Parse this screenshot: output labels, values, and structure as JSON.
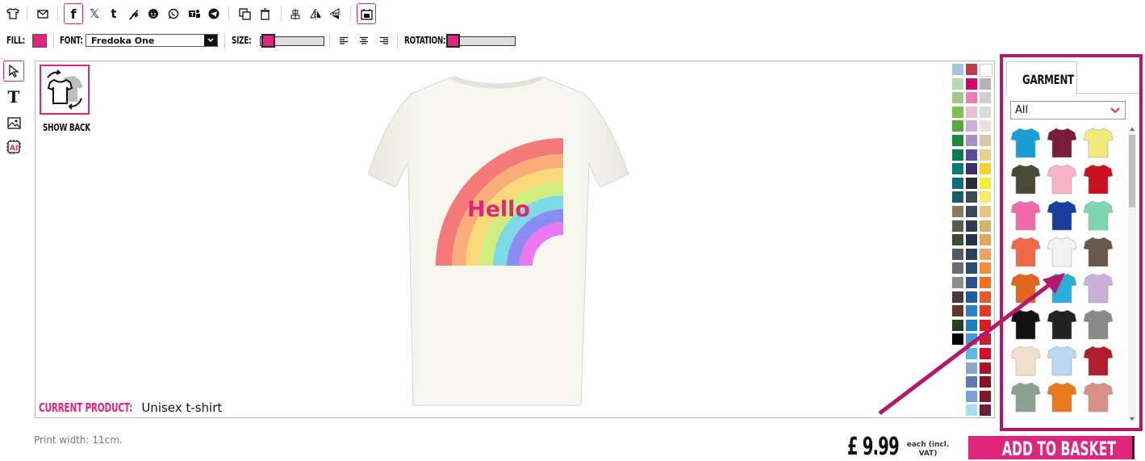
{
  "toolbar": {
    "fill_label": "FILL:",
    "fill_color": "#e0257c",
    "font_label": "FONT:",
    "font_value": "Fredoka One",
    "size_label": "SIZE:",
    "rotation_label": "ROTATION:",
    "accent_color": "#e0257c"
  },
  "side_tools": [
    "select-tool",
    "text-tool",
    "image-tool",
    "ai-tool"
  ],
  "show_back_label": "SHOW BACK",
  "design": {
    "text": "Hello",
    "text_color": "#e0257c"
  },
  "current_product": {
    "label": "CURRENT PRODUCT:",
    "value": "Unisex t-shirt"
  },
  "print_width": "Print width: 11cm.",
  "price": {
    "value": "£ 9.99",
    "note_line1": "each (incl.",
    "note_line2": "VAT)"
  },
  "add_to_basket": "ADD TO BASKET",
  "garment_panel": {
    "tab": "GARMENT",
    "filter_value": "All"
  },
  "palette": [
    [
      "#a8c4d8",
      "#c0394f",
      "#ffffff"
    ],
    [
      "#b7d9b5",
      "#d1006a",
      "#b3b3b3"
    ],
    [
      "#a6c48a",
      "#f07cb3",
      "#cfcfcf"
    ],
    [
      "#7cc24a",
      "#e7c0d1",
      "#dcdcdc"
    ],
    [
      "#5aa63a",
      "#cdb0d6",
      "#e8e2d4"
    ],
    [
      "#1b8a3c",
      "#a990c2",
      "#d9c9a8"
    ],
    [
      "#0e7a52",
      "#5c4b9c",
      "#e7d48b"
    ],
    [
      "#0c7a73",
      "#3d2e6e",
      "#f2d22e"
    ],
    [
      "#0e6b7a",
      "#2c2c38",
      "#f1ee3a"
    ],
    [
      "#1b5a6a",
      "#3a4b58",
      "#f5ea6a"
    ],
    [
      "#8a7a5c",
      "#39495b",
      "#e8c77a"
    ],
    [
      "#555e4a",
      "#2e3e52",
      "#d4b36a"
    ],
    [
      "#3e4b3a",
      "#24344a",
      "#e3a75a"
    ],
    [
      "#525a66",
      "#29405c",
      "#f1a462"
    ],
    [
      "#6a6e72",
      "#2d4873",
      "#f08c3a"
    ],
    [
      "#8a8e92",
      "#2a4f8c",
      "#f0701e"
    ],
    [
      "#4a3a3a",
      "#1f5ea3",
      "#e45a2a"
    ],
    [
      "#5a3a2a",
      "#2a82c6",
      "#e03a2a"
    ],
    [
      "#263d26",
      "#1c7ebf",
      "#d42020"
    ],
    [
      "#000000",
      "#3aa0d8",
      "#c81e2e"
    ],
    [
      "",
      "#5cb8e6",
      "#d80a2a"
    ],
    [
      "",
      "#8aa8c8",
      "#b0102a"
    ],
    [
      "",
      "#5a7eb4",
      "#8a0e26"
    ],
    [
      "",
      "#7aa0d4",
      "#7a1a2a"
    ],
    [
      "",
      "#a6e0f4",
      "#6a1e3a"
    ]
  ],
  "garments": [
    [
      "#1a9fd4",
      "#7a1d3a",
      "#f2ea7a"
    ],
    [
      "#4a4a36",
      "#f6b5c8",
      "#c8101e"
    ],
    [
      "#ee6aa8",
      "#1a3e9e",
      "#7ed6b0"
    ],
    [
      "#f06a4a",
      "#f2f2f2",
      "#6a584a"
    ],
    [
      "#e0661e",
      "#2ab0d8",
      "#c9b0d8"
    ],
    [
      "#111111",
      "#222222",
      "#8a8a8a"
    ],
    [
      "#f1e0cc",
      "#bcd8f0",
      "#b01e2e"
    ],
    [
      "#8aa090",
      "#e87a1e",
      "#d89088"
    ]
  ]
}
